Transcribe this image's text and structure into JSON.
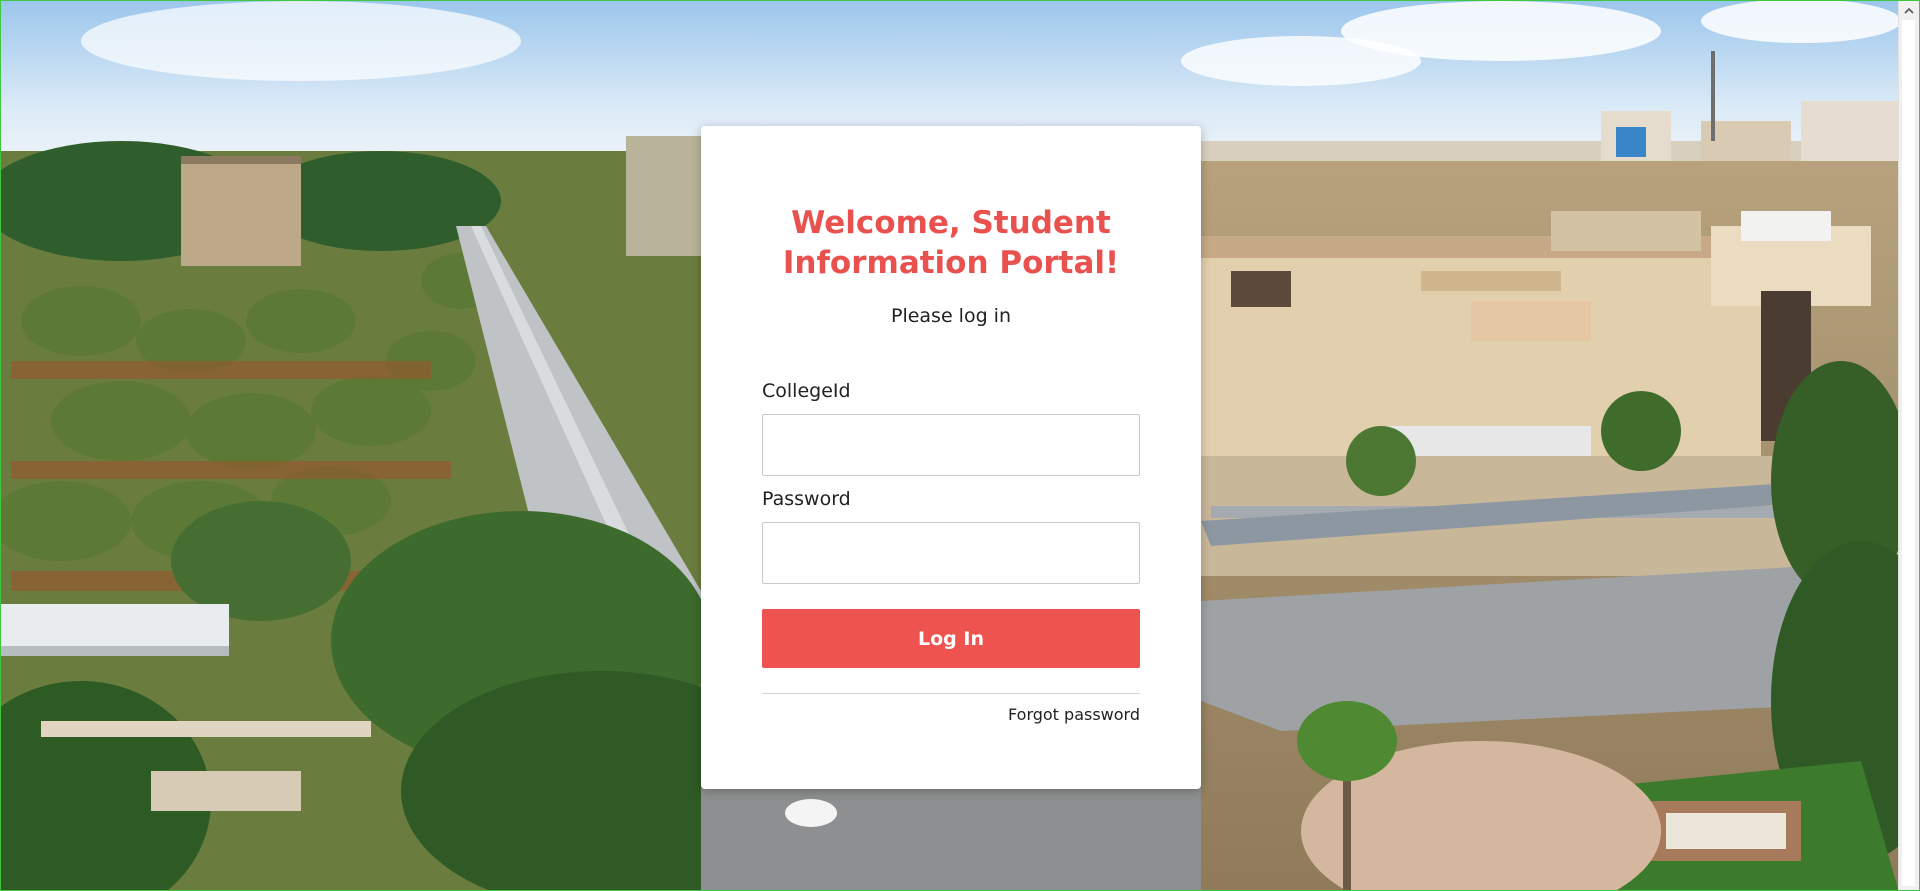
{
  "login_card": {
    "title": "Welcome, Student Information Portal!",
    "subtitle": "Please log in",
    "college_id_label": "CollegeId",
    "college_id_value": "",
    "password_label": "Password",
    "password_value": "",
    "login_button": "Log In",
    "forgot_password": "Forgot password"
  },
  "scrollbar": {
    "up_icon": "chevron-up-icon"
  },
  "colors": {
    "accent": "#ef5350",
    "title": "#e9514f",
    "card_background": "#ffffff",
    "input_border": "#c9c9c9"
  },
  "background": {
    "scene": "campus-aerial-photo"
  }
}
